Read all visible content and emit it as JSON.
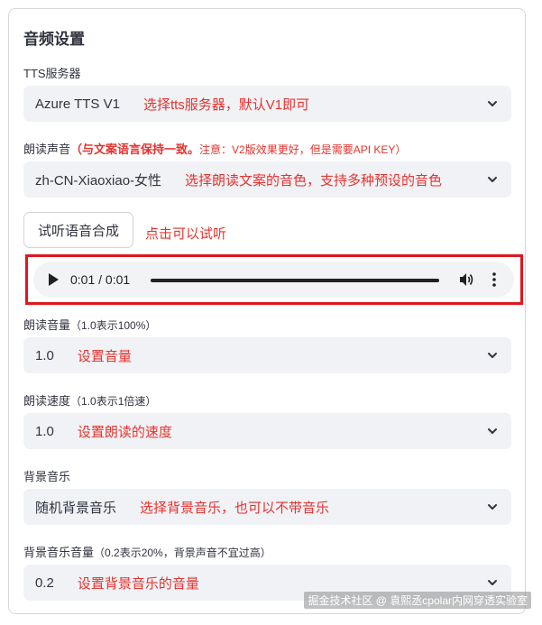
{
  "section_title": "音频设置",
  "tts_server": {
    "label": "TTS服务器",
    "value": "Azure TTS V1",
    "note": "选择tts服务器，默认V1即可"
  },
  "voice": {
    "label_prefix": "朗读声音",
    "label_bold": "（与文案语言保持一致。",
    "label_note": "注意：V2版效果更好，但是需要API KEY）",
    "value": "zh-CN-Xiaoxiao-女性",
    "note": "选择朗读文案的音色，支持多种预设的音色"
  },
  "preview": {
    "button_label": "试听语音合成",
    "note": "点击可以试听"
  },
  "audio_player": {
    "time": "0:01 / 0:01",
    "progress": 1.0,
    "icons": [
      "play-icon",
      "volume-icon",
      "more-options-icon"
    ],
    "highlight_color": "#e0161f"
  },
  "volume": {
    "label": "朗读音量",
    "label_hint": "（1.0表示100%）",
    "value": "1.0",
    "note": "设置音量"
  },
  "speed": {
    "label": "朗读速度",
    "label_hint": "（1.0表示1倍速）",
    "value": "1.0",
    "note": "设置朗读的速度"
  },
  "bgm": {
    "label": "背景音乐",
    "value": "随机背景音乐",
    "note": "选择背景音乐，也可以不带音乐"
  },
  "bgm_volume": {
    "label": "背景音乐音量",
    "label_hint": "（0.2表示20%，背景声音不宜过高）",
    "value": "0.2",
    "note": "设置背景音乐的音量"
  },
  "watermark": "掘金技术社区 @ 袁熙丞cpolar内网穿透实验室",
  "colors": {
    "accent_red": "#e8322d",
    "select_bg": "#f0f2f6",
    "text": "#31333f"
  }
}
